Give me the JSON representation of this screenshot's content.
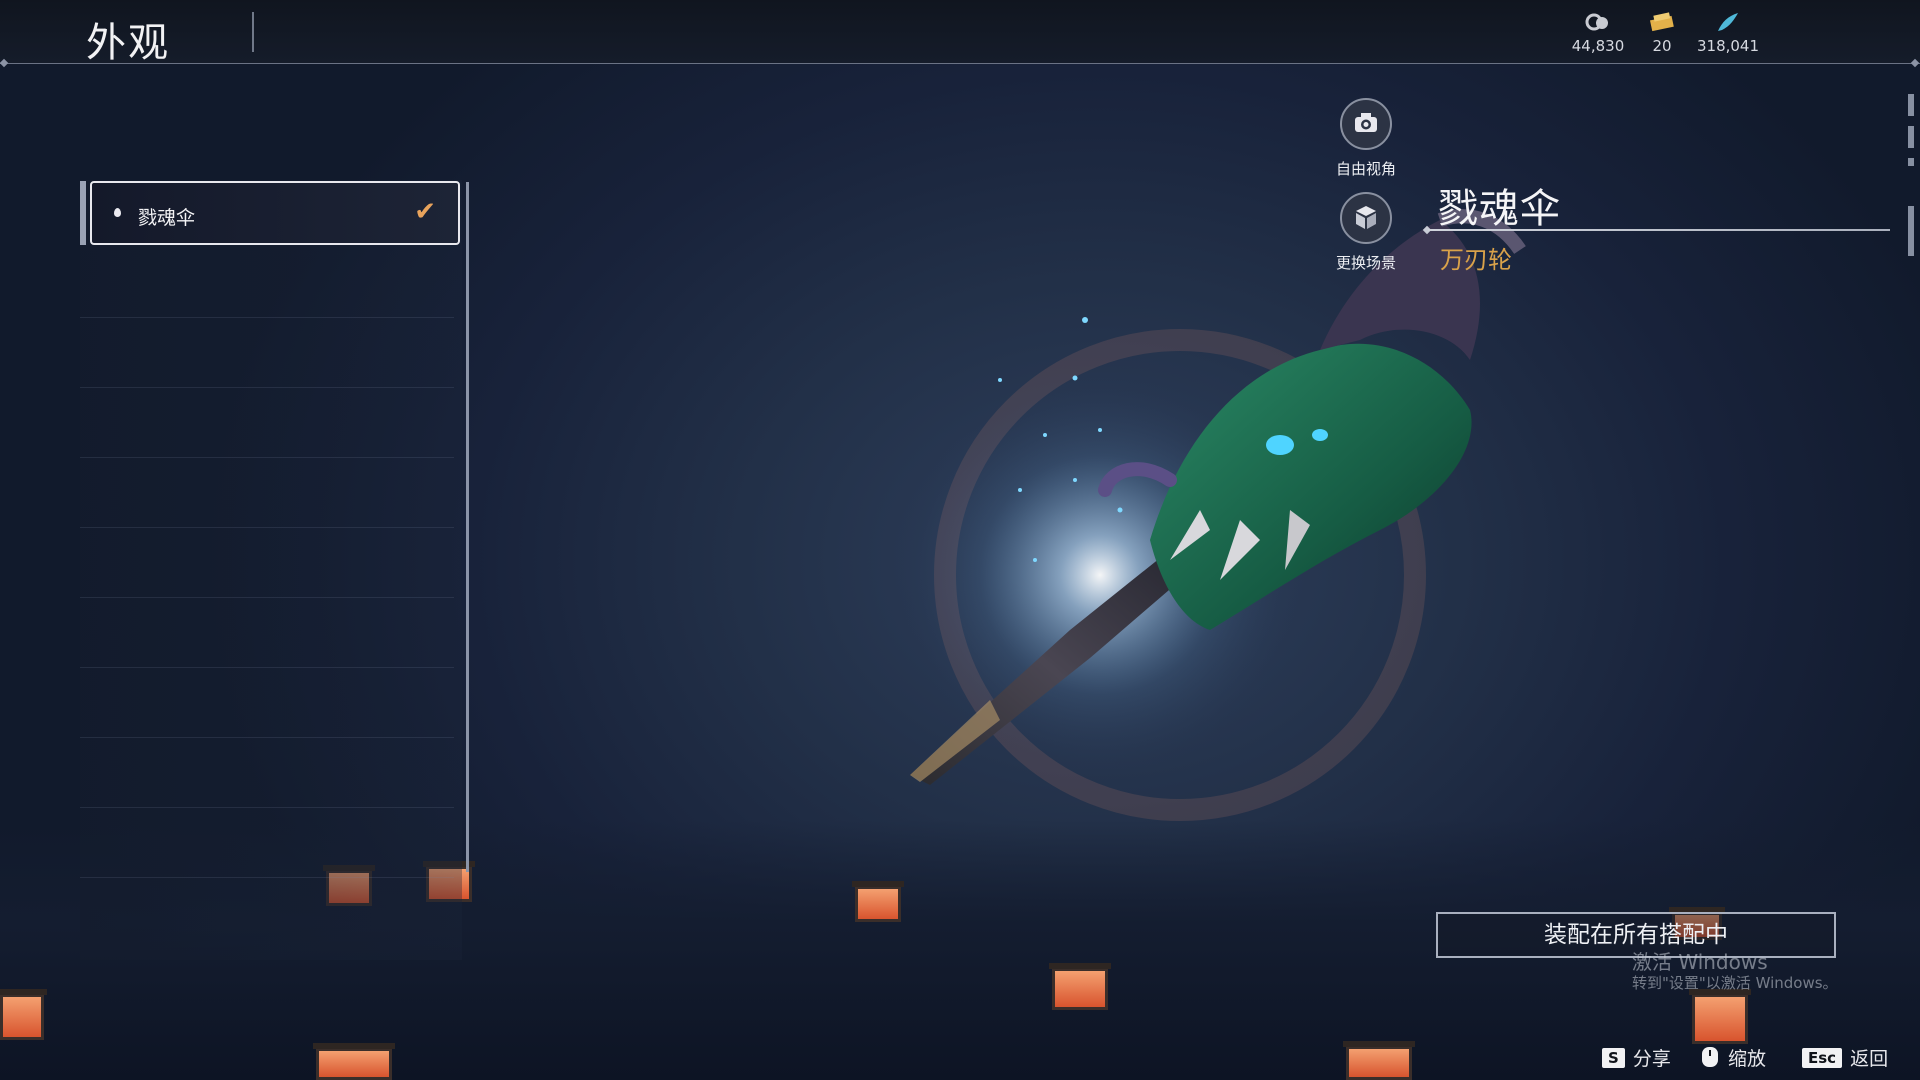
{
  "header": {
    "title": "外观",
    "currencies": [
      {
        "icon": "silver-coin-icon",
        "value": "44,830",
        "color": "#c9cbd2"
      },
      {
        "icon": "gold-ticket-icon",
        "value": "20",
        "color": "#e3b14a"
      },
      {
        "icon": "feather-icon",
        "value": "318,041",
        "color": "#4fb9d9"
      }
    ]
  },
  "skin_list": {
    "items": [
      {
        "label": "戮魂伞",
        "selected": true,
        "icon": "drop-icon"
      }
    ]
  },
  "side_buttons": [
    {
      "label": "自由视角",
      "icon": "camera-icon"
    },
    {
      "label": "更换场景",
      "icon": "scene-cube-icon"
    }
  ],
  "item": {
    "name": "戮魂伞",
    "subtitle": "万刃轮"
  },
  "equip_button": "装配在所有搭配中",
  "watermark": {
    "line1": "激活 Windows",
    "line2": "转到\"设置\"以激活 Windows。"
  },
  "key_hints": [
    {
      "key": "S",
      "label": "分享"
    },
    {
      "key": "mouse-icon",
      "label": "缩放"
    },
    {
      "key": "Esc",
      "label": "返回"
    }
  ],
  "colors": {
    "accent_orange": "#e8a35c",
    "subtitle_gold": "#d9a24a"
  }
}
